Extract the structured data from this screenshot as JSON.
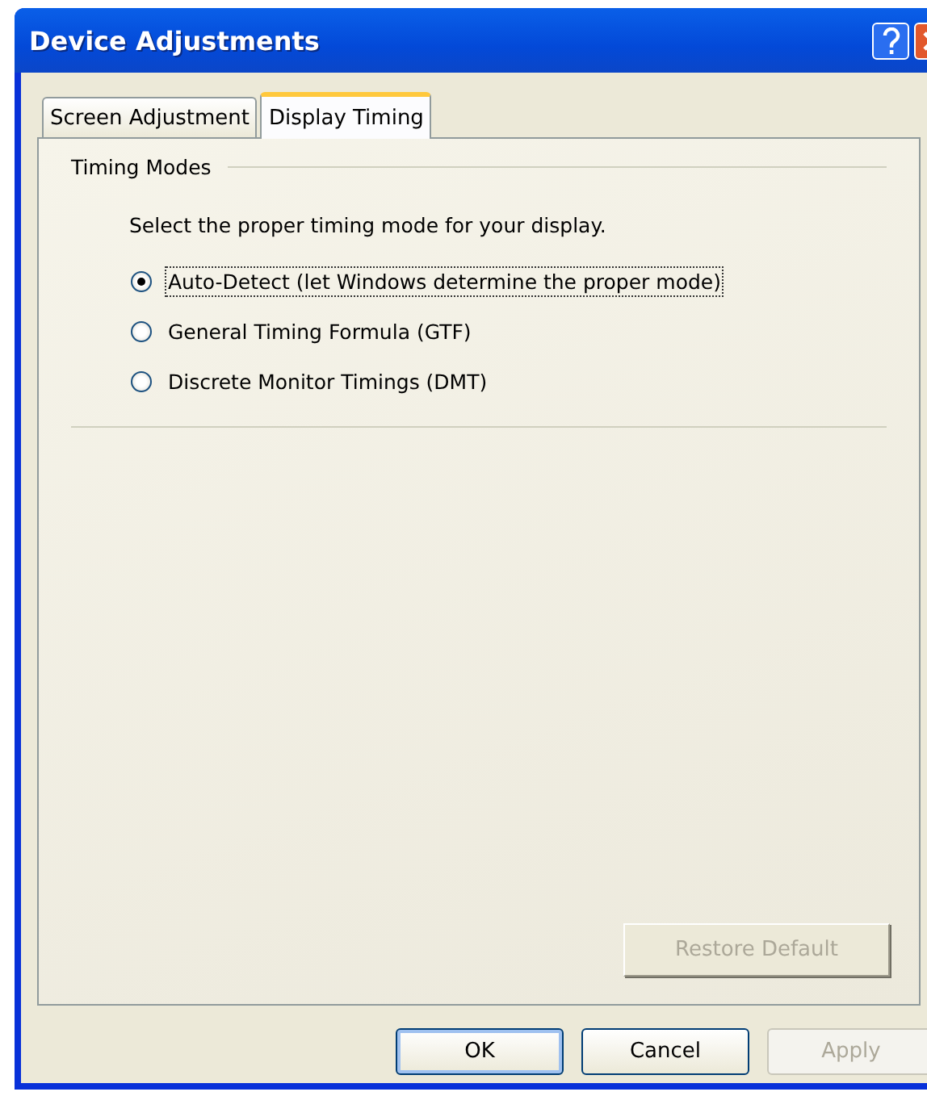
{
  "window": {
    "title": "Device Adjustments"
  },
  "tabs": [
    {
      "label": "Screen Adjustment",
      "selected": false
    },
    {
      "label": "Display Timing",
      "selected": true
    }
  ],
  "group": {
    "title": "Timing Modes",
    "instruction": "Select the proper timing mode for your display.",
    "options": [
      {
        "label": "Auto-Detect (let Windows determine the proper mode)",
        "selected": true,
        "focused": true
      },
      {
        "label": "General Timing Formula (GTF)",
        "selected": false,
        "focused": false
      },
      {
        "label": "Discrete Monitor Timings (DMT)",
        "selected": false,
        "focused": false
      }
    ]
  },
  "restore_button": {
    "label": "Restore Default",
    "disabled": true
  },
  "buttons": [
    {
      "label": "OK",
      "disabled": false,
      "default": true
    },
    {
      "label": "Cancel",
      "disabled": false,
      "default": false
    },
    {
      "label": "Apply",
      "disabled": true,
      "default": false
    }
  ]
}
